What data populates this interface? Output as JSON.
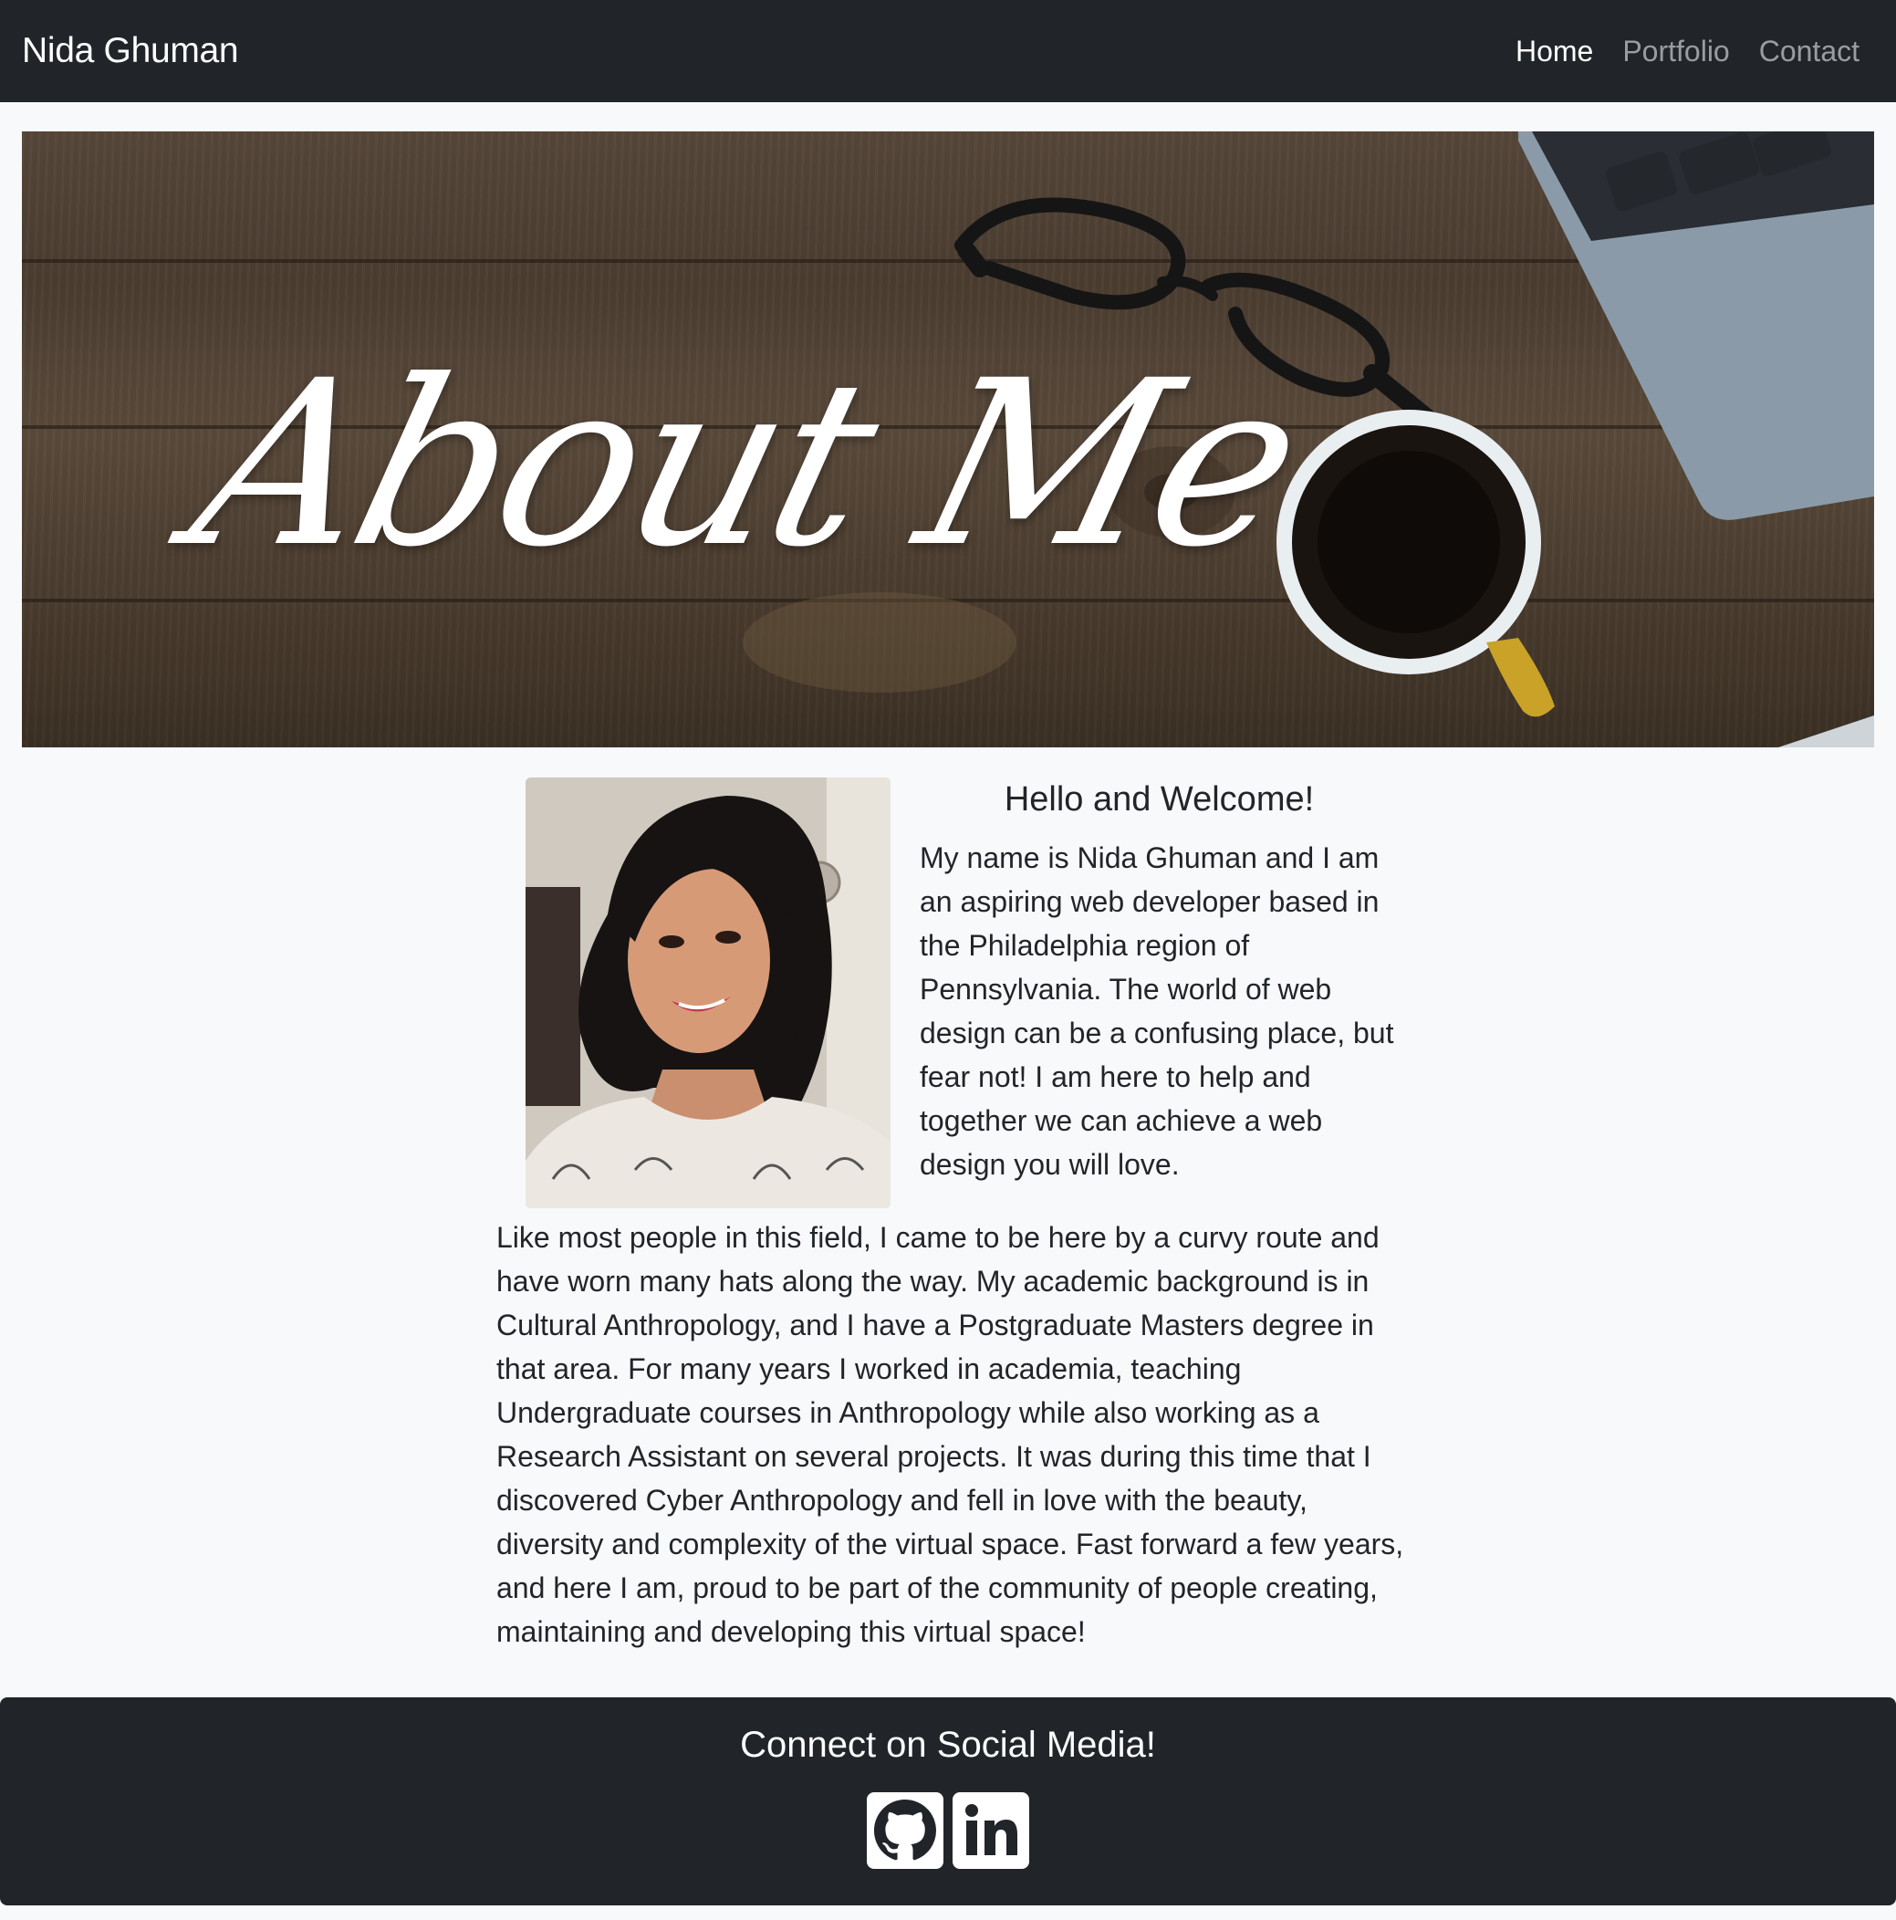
{
  "navbar": {
    "brand": "Nida Ghuman",
    "links": [
      {
        "label": "Home",
        "active": true
      },
      {
        "label": "Portfolio",
        "active": false
      },
      {
        "label": "Contact",
        "active": false
      }
    ]
  },
  "hero": {
    "title": "About Me"
  },
  "about": {
    "heading": "Hello and Welcome!",
    "intro": "My name is Nida Ghuman and I am an aspiring web developer based in the Philadelphia region of Pennsylvania. The world of web design can be a confusing place, but fear not! I am here to help and together we can achieve a web design you will love.",
    "story": "Like most people in this field, I came to be here by a curvy route and have worn many hats along the way. My academic background is in Cultural Anthropology, and I have a Postgraduate Masters degree in that area. For many years I worked in academia, teaching Undergraduate courses in Anthropology while also working as a Research Assistant on several projects. It was during this time that I discovered Cyber Anthropology and fell in love with the beauty, diversity and complexity of the virtual space. Fast forward a few years, and here I am, proud to be part of the community of people creating, maintaining and developing this virtual space!"
  },
  "footer": {
    "heading": "Connect on Social Media!",
    "icons": [
      "github-icon",
      "linkedin-icon"
    ]
  },
  "colors": {
    "navbar_bg": "#212529",
    "page_bg": "#f8f9fa",
    "text": "#212529",
    "nav_active": "#ffffff",
    "nav_inactive": "rgba(255,255,255,0.55)"
  }
}
